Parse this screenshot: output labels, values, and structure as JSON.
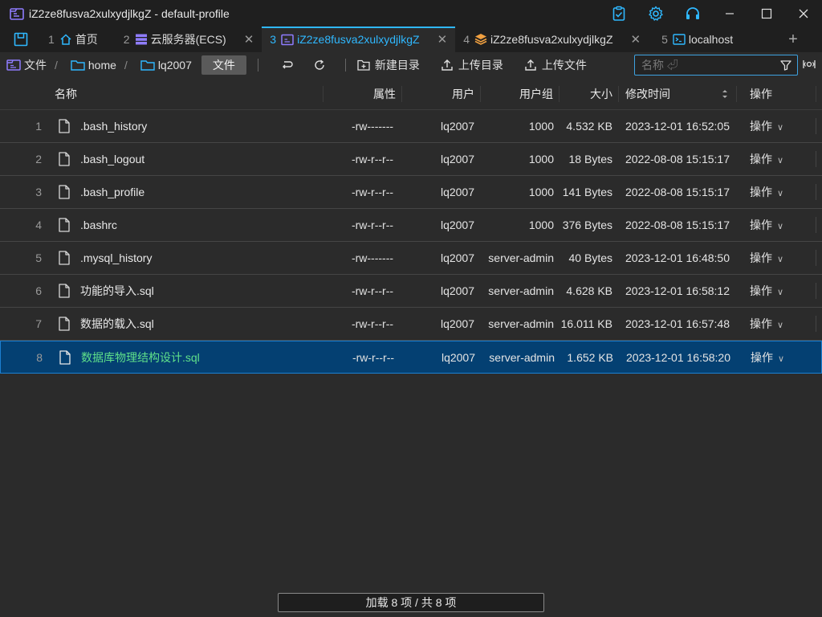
{
  "window": {
    "title": "iZ2ze8fusva2xulxydjlkgZ  - default-profile"
  },
  "tabs": [
    {
      "num": "1",
      "label": "首页",
      "icon": "home-icon",
      "active": false,
      "closable": false
    },
    {
      "num": "2",
      "label": "云服务器(ECS)",
      "icon": "server-icon",
      "active": false,
      "closable": true
    },
    {
      "num": "3",
      "label": "iZ2ze8fusva2xulxydjlkgZ",
      "icon": "folder-icon",
      "active": true,
      "closable": true
    },
    {
      "num": "4",
      "label": "iZ2ze8fusva2xulxydjlkgZ",
      "icon": "stack-icon",
      "active": false,
      "closable": true
    },
    {
      "num": "5",
      "label": "localhost",
      "icon": "terminal-icon",
      "active": false,
      "closable": false
    }
  ],
  "toolbar": {
    "crumb_root": "文件",
    "crumb_home": "home",
    "crumb_user": "lq2007",
    "file_button": "文件",
    "new_dir": "新建目录",
    "upload_dir": "上传目录",
    "upload_file": "上传文件",
    "search_placeholder": "名称 ⏎"
  },
  "columns": {
    "name": "名称",
    "attr": "属性",
    "user": "用户",
    "group": "用户组",
    "size": "大小",
    "mtime": "修改时间",
    "op": "操作"
  },
  "files": [
    {
      "idx": "1",
      "name": ".bash_history",
      "attr": "-rw-------",
      "user": "lq2007",
      "group": "1000",
      "size": "4.532 KB",
      "mtime": "2023-12-01 16:52:05",
      "op": "操作"
    },
    {
      "idx": "2",
      "name": ".bash_logout",
      "attr": "-rw-r--r--",
      "user": "lq2007",
      "group": "1000",
      "size": "18 Bytes",
      "mtime": "2022-08-08 15:15:17",
      "op": "操作"
    },
    {
      "idx": "3",
      "name": ".bash_profile",
      "attr": "-rw-r--r--",
      "user": "lq2007",
      "group": "1000",
      "size": "141 Bytes",
      "mtime": "2022-08-08 15:15:17",
      "op": "操作"
    },
    {
      "idx": "4",
      "name": ".bashrc",
      "attr": "-rw-r--r--",
      "user": "lq2007",
      "group": "1000",
      "size": "376 Bytes",
      "mtime": "2022-08-08 15:15:17",
      "op": "操作"
    },
    {
      "idx": "5",
      "name": ".mysql_history",
      "attr": "-rw-------",
      "user": "lq2007",
      "group": "server-admin",
      "size": "40 Bytes",
      "mtime": "2023-12-01 16:48:50",
      "op": "操作"
    },
    {
      "idx": "6",
      "name": "功能的导入.sql",
      "attr": "-rw-r--r--",
      "user": "lq2007",
      "group": "server-admin",
      "size": "4.628 KB",
      "mtime": "2023-12-01 16:58:12",
      "op": "操作"
    },
    {
      "idx": "7",
      "name": "数据的载入.sql",
      "attr": "-rw-r--r--",
      "user": "lq2007",
      "group": "server-admin",
      "size": "16.011 KB",
      "mtime": "2023-12-01 16:57:48",
      "op": "操作"
    },
    {
      "idx": "8",
      "name": "数据库物理结构设计.sql",
      "attr": "-rw-r--r--",
      "user": "lq2007",
      "group": "server-admin",
      "size": "1.652 KB",
      "mtime": "2023-12-01 16:58:20",
      "op": "操作",
      "selected": true
    }
  ],
  "footer": {
    "load_label": "加载 8 项 / 共 8 项"
  },
  "colors": {
    "accent": "#2fb8ff",
    "selected_row": "#044072",
    "selected_name": "#5fe08a",
    "brand_purple": "#7b6cf6"
  }
}
